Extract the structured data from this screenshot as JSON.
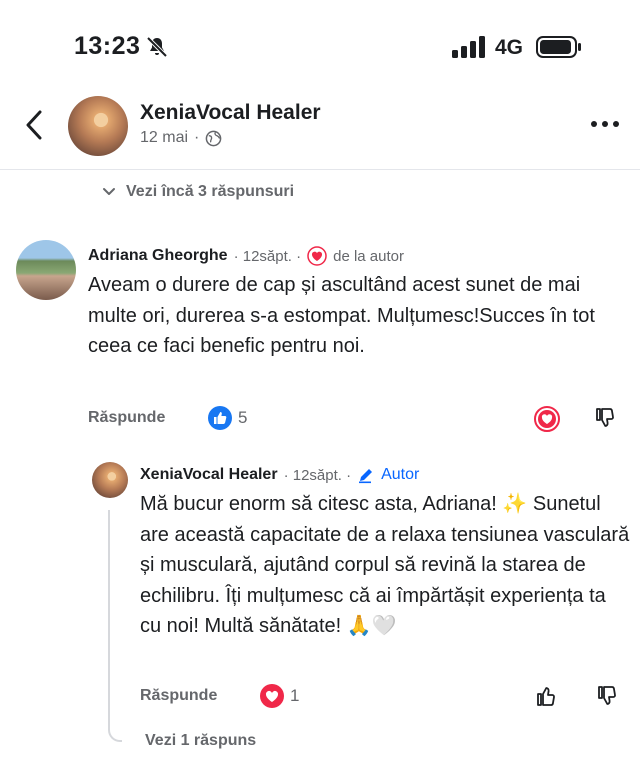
{
  "status_bar": {
    "time": "13:23",
    "network": "4G"
  },
  "header": {
    "name": "XeniaVocal Healer",
    "date": "12 mai",
    "separator": "·"
  },
  "view_more_replies": "Vezi încă 3 răspunsuri",
  "comment": {
    "author": "Adriana Gheorghe",
    "time": "· 12săpt. ·",
    "heart_note": "de la autor",
    "text": "Aveam o durere  de cap și ascultând acest sunet de mai multe ori, durerea s-a estompat. Mulțumesc!Succes în tot ceea ce faci benefic pentru noi.",
    "reply_label": "Răspunde",
    "like_count": "5"
  },
  "reply": {
    "author": "XeniaVocal Healer",
    "time": "· 12săpt. ·",
    "author_tag": "Autor",
    "text": "Mă bucur enorm să citesc asta, Adriana! ✨ Sunetul are această capacitate de a relaxa tensiunea vasculară și musculară, ajutând corpul să revină la starea de echilibru. Îți mulțumesc că ai împărtășit experiența ta cu noi! Multă sănătate! 🙏🤍",
    "reply_label": "Răspunde",
    "love_count": "1"
  },
  "view_replies": "Vezi 1 răspuns",
  "colors": {
    "brand_blue": "#0866ff",
    "love_red": "#f02849",
    "meta_gray": "#65676b"
  }
}
